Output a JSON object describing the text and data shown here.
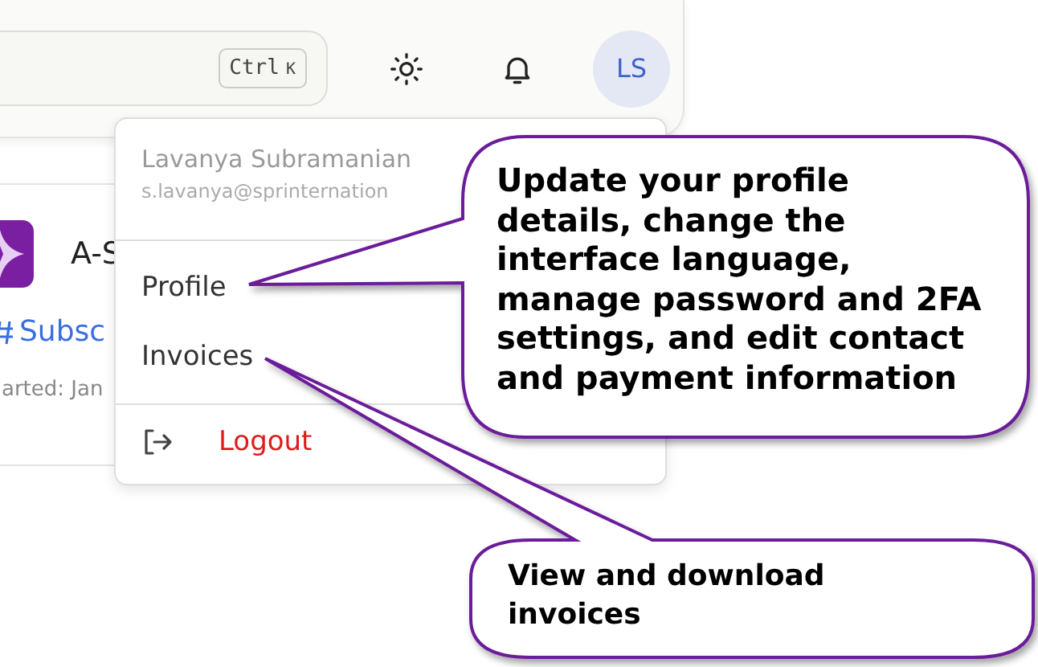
{
  "top_bar": {
    "search": {
      "shortcut": [
        "Ctrl",
        "K"
      ]
    },
    "avatar": "LS"
  },
  "card": {
    "title": "A-S",
    "link": "Subsc",
    "meta": "arted: Jan"
  },
  "user_menu": {
    "name": "Lavanya Subramanian",
    "email": "s.lavanya@sprinternation",
    "items": [
      {
        "label": "Profile",
        "kind": "link"
      },
      {
        "label": "Invoices",
        "kind": "link"
      },
      {
        "label": "Logout",
        "kind": "logout"
      }
    ]
  },
  "callouts": [
    {
      "text": "Update your profile details, change the interface language, manage password and 2FA settings, and edit contact and payment information",
      "kind": "large"
    },
    {
      "text": "View and download invoices",
      "kind": "small"
    }
  ]
}
